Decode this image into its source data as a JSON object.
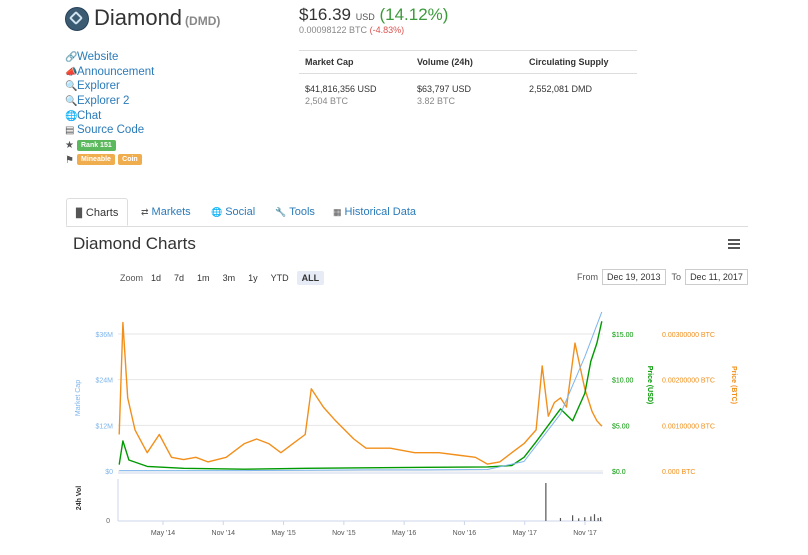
{
  "coin": {
    "name": "Diamond",
    "symbol": "(DMD)"
  },
  "links": {
    "website": "Website",
    "announcement": "Announcement",
    "explorer": "Explorer",
    "explorer2": "Explorer 2",
    "chat": "Chat",
    "source_code": "Source Code",
    "rank_badge": "Rank 151",
    "tag_mineable": "Mineable",
    "tag_coin": "Coin"
  },
  "price": {
    "usd": "$16.39",
    "usd_unit": "USD",
    "change": "(14.12%)",
    "btc": "0.00098122 BTC",
    "btc_change": "(-4.83%)"
  },
  "stats": {
    "headers": [
      "Market Cap",
      "Volume (24h)",
      "Circulating Supply"
    ],
    "market_cap_usd": "$41,816,356 USD",
    "market_cap_btc": "2,504 BTC",
    "volume_usd": "$63,797 USD",
    "volume_btc": "3.82 BTC",
    "supply": "2,552,081 DMD"
  },
  "tabs": [
    "Charts",
    "Markets",
    "Social",
    "Tools",
    "Historical Data"
  ],
  "charts_title": "Diamond Charts",
  "zoom": {
    "label": "Zoom",
    "options": [
      "1d",
      "7d",
      "1m",
      "3m",
      "1y",
      "YTD",
      "ALL"
    ],
    "selected": "ALL"
  },
  "range": {
    "from_label": "From",
    "from": "Dec 19, 2013",
    "to_label": "To",
    "to": "Dec 11, 2017"
  },
  "colors": {
    "market_cap": "#7cb5ec",
    "price_usd": "#009900",
    "price_btc": "#f28f1b",
    "link": "#2b7bb9"
  },
  "chart_data": {
    "type": "line",
    "x_ticks": [
      "May '14",
      "Nov '14",
      "May '15",
      "Nov '15",
      "May '16",
      "Nov '16",
      "May '17",
      "Nov '17"
    ],
    "axes": {
      "market_cap": {
        "label": "Market Cap",
        "ticks": [
          "$0",
          "$12M",
          "$24M",
          "$36M"
        ],
        "range": [
          0,
          36000000
        ]
      },
      "price_usd": {
        "label": "Price (USD)",
        "ticks": [
          "$0.0",
          "$5.00",
          "$10.00",
          "$15.00"
        ],
        "range": [
          0,
          15
        ]
      },
      "price_btc": {
        "label": "Price (BTC)",
        "ticks": [
          "0.000 BTC",
          "0.00100000 BTC",
          "0.00200000 BTC",
          "0.00300000 BTC"
        ],
        "range": [
          0,
          0.003
        ]
      },
      "volume": {
        "label": "24h Vol",
        "ticks": [
          "0"
        ]
      }
    },
    "series": [
      {
        "name": "Price (BTC)",
        "axis": "price_btc",
        "x": [
          2013.97,
          2014.0,
          2014.04,
          2014.1,
          2014.2,
          2014.3,
          2014.4,
          2014.5,
          2014.6,
          2014.7,
          2014.85,
          2015.0,
          2015.1,
          2015.2,
          2015.3,
          2015.4,
          2015.5,
          2015.55,
          2015.65,
          2015.75,
          2015.9,
          2016.0,
          2016.2,
          2016.4,
          2016.6,
          2016.75,
          2016.9,
          2017.0,
          2017.1,
          2017.2,
          2017.3,
          2017.4,
          2017.45,
          2017.5,
          2017.55,
          2017.6,
          2017.65,
          2017.72,
          2017.8,
          2017.86,
          2017.9,
          2017.94
        ],
        "values": [
          0.0008,
          0.00325,
          0.0016,
          0.0009,
          0.0004,
          0.0008,
          0.0003,
          0.00025,
          0.0003,
          0.0002,
          0.0003,
          0.0006,
          0.0007,
          0.0006,
          0.0004,
          0.0006,
          0.0008,
          0.0018,
          0.0014,
          0.0011,
          0.0007,
          0.0005,
          0.0005,
          0.0004,
          0.0004,
          0.00035,
          0.0003,
          0.00015,
          0.0002,
          0.0004,
          0.0006,
          0.0009,
          0.0023,
          0.0012,
          0.0015,
          0.0016,
          0.0014,
          0.0028,
          0.0018,
          0.0013,
          0.0011,
          0.00098
        ]
      },
      {
        "name": "Price (USD)",
        "axis": "price_usd",
        "x": [
          2013.97,
          2014.0,
          2014.05,
          2014.2,
          2014.5,
          2015.0,
          2015.5,
          2016.0,
          2016.5,
          2017.0,
          2017.2,
          2017.3,
          2017.4,
          2017.5,
          2017.6,
          2017.7,
          2017.8,
          2017.85,
          2017.9,
          2017.94
        ],
        "values": [
          0.7,
          3.3,
          1.2,
          0.5,
          0.3,
          0.2,
          0.3,
          0.35,
          0.4,
          0.45,
          0.6,
          1.5,
          3.2,
          5.0,
          6.8,
          5.5,
          8.5,
          12.0,
          14.0,
          16.39
        ]
      },
      {
        "name": "Market Cap",
        "axis": "market_cap",
        "x": [
          2013.97,
          2014.5,
          2015.0,
          2015.5,
          2016.0,
          2016.5,
          2017.0,
          2017.3,
          2017.6,
          2017.8,
          2017.94
        ],
        "values": [
          100000,
          100000,
          100000,
          200000,
          300000,
          300000,
          400000,
          2500000,
          15000000,
          30000000,
          41816356
        ]
      }
    ],
    "volume": {
      "x": [
        2017.48,
        2017.6,
        2017.7,
        2017.75,
        2017.8,
        2017.85,
        2017.88,
        2017.91,
        2017.93
      ],
      "values": [
        1.0,
        0.08,
        0.15,
        0.07,
        0.1,
        0.12,
        0.18,
        0.08,
        0.1
      ]
    }
  }
}
